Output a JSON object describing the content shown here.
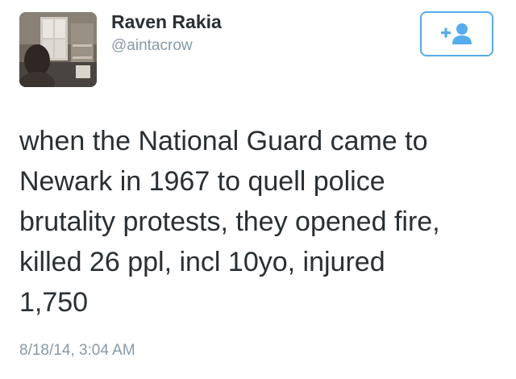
{
  "author": {
    "display_name": "Raven Rakia",
    "handle": "@aintacrow",
    "avatar_icon": "profile-photo"
  },
  "follow_button": {
    "icon": "add-user-icon",
    "accent_color": "#55acee"
  },
  "tweet": {
    "lines": [
      "when the National Guard came to",
      "Newark in 1967 to quell police",
      "brutality protests, they opened fire,",
      "killed 26 ppl, incl 10yo, injured",
      "1,750"
    ],
    "timestamp": "8/18/14, 3:04 AM"
  },
  "colors": {
    "text": "#292f33",
    "secondary_text": "#8899a6",
    "accent": "#55acee"
  }
}
